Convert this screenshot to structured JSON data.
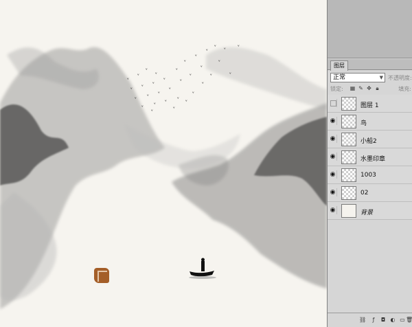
{
  "layers_panel": {
    "tab_label": "图层",
    "blend_mode": "正常",
    "opacity_label": "不透明度:",
    "lock_label": "锁定:",
    "fill_label": "填充:",
    "layers": [
      {
        "name": "图层 1",
        "visible": false,
        "thumb": "transparent"
      },
      {
        "name": "鸟",
        "visible": true,
        "thumb": "transparent"
      },
      {
        "name": "小船2",
        "visible": true,
        "thumb": "transparent"
      },
      {
        "name": "水墨印章",
        "visible": true,
        "thumb": "transparent"
      },
      {
        "name": "1003",
        "visible": true,
        "thumb": "transparent"
      },
      {
        "name": "02",
        "visible": true,
        "thumb": "transparent"
      },
      {
        "name": "背景",
        "visible": true,
        "thumb": "solid"
      }
    ]
  },
  "canvas": {
    "paper_color": "#f6f4ef",
    "ink_color": "#1a1a1a",
    "seal_color": "#a0561e"
  }
}
